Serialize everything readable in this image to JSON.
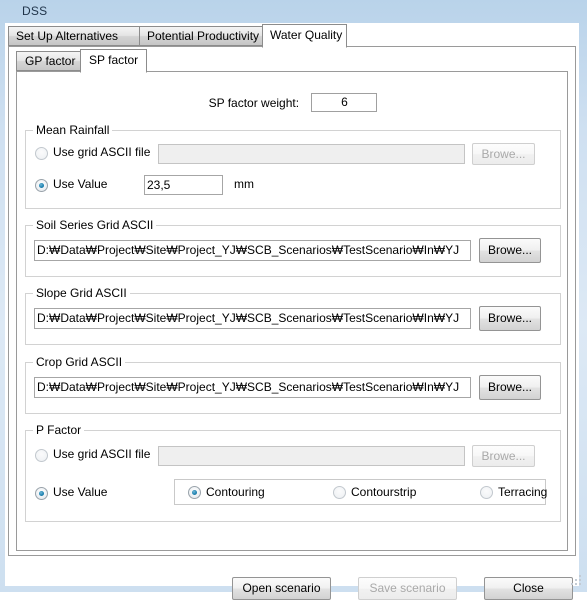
{
  "window": {
    "title": "DSS"
  },
  "outer_tabs": [
    {
      "label": "Set Up Alternatives",
      "active": false
    },
    {
      "label": "Potential Productivity",
      "active": false
    },
    {
      "label": "Water Quality",
      "active": true
    }
  ],
  "inner_tabs": [
    {
      "label": "GP factor",
      "active": false
    },
    {
      "label": "SP factor",
      "active": true
    }
  ],
  "weight": {
    "label": "SP factor weight:",
    "value": "6"
  },
  "mean_rainfall": {
    "title": "Mean Rainfall",
    "use_grid_label": "Use grid ASCII file",
    "use_grid_checked": false,
    "grid_path": "",
    "browse_label": "Browe...",
    "browse_enabled": false,
    "use_value_label": "Use Value",
    "use_value_checked": true,
    "value": "23,5",
    "unit": "mm"
  },
  "soil_series": {
    "title": "Soil Series Grid ASCII",
    "path": "D:₩Data₩Project₩Site₩Project_YJ₩SCB_Scenarios₩TestScenario₩In₩YJ",
    "browse_label": "Browe...",
    "browse_enabled": true
  },
  "slope_grid": {
    "title": "Slope Grid ASCII",
    "path": "D:₩Data₩Project₩Site₩Project_YJ₩SCB_Scenarios₩TestScenario₩In₩YJ",
    "browse_label": "Browe...",
    "browse_enabled": true
  },
  "crop_grid": {
    "title": "Crop Grid ASCII",
    "path": "D:₩Data₩Project₩Site₩Project_YJ₩SCB_Scenarios₩TestScenario₩In₩YJ",
    "browse_label": "Browe...",
    "browse_enabled": true
  },
  "p_factor": {
    "title": "P Factor",
    "use_grid_label": "Use grid ASCII file",
    "use_grid_checked": false,
    "grid_path": "",
    "browse_label": "Browe...",
    "browse_enabled": false,
    "use_value_label": "Use Value",
    "use_value_checked": true,
    "options": [
      {
        "label": "Contouring",
        "checked": true
      },
      {
        "label": "Contourstrip",
        "checked": false
      },
      {
        "label": "Terracing",
        "checked": false
      }
    ]
  },
  "footer": {
    "open_label": "Open scenario",
    "save_label": "Save scenario",
    "save_enabled": false,
    "close_label": "Close"
  },
  "colors": {
    "accent_radio": "#1a7fae",
    "titlebar_top": "#b9d3ea",
    "dialog_face": "#ffffff",
    "groupbox_border": "#d2d2d2"
  }
}
